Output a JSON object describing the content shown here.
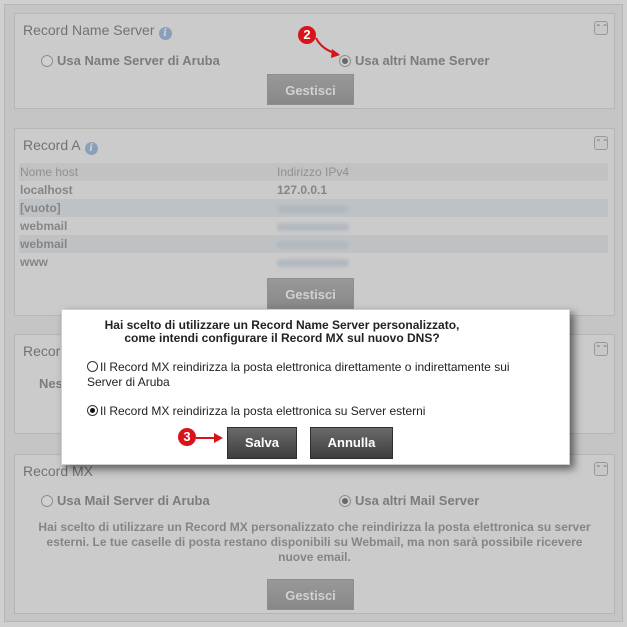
{
  "ns_section": {
    "title": "Record Name Server",
    "option_aruba": "Usa Name Server di Aruba",
    "option_other": "Usa altri Name Server",
    "selected": "option_other",
    "button": "Gestisci"
  },
  "a_section": {
    "title": "Record A",
    "headers": [
      "Nome host",
      "Indirizzo IPv4"
    ],
    "rows": [
      {
        "host": "localhost",
        "ip": "127.0.0.1"
      },
      {
        "host": "[vuoto]",
        "ip": ""
      },
      {
        "host": "webmail",
        "ip": ""
      },
      {
        "host": "webmail",
        "ip": ""
      },
      {
        "host": "www",
        "ip": ""
      }
    ],
    "button": "Gestisci"
  },
  "third_section": {
    "title": "Recor",
    "partial_text": "Nes"
  },
  "mx_section": {
    "title": "Record MX",
    "option_aruba": "Usa Mail Server di Aruba",
    "option_other": "Usa altri Mail Server",
    "selected": "option_other",
    "note": "Hai scelto di utilizzare un Record MX personalizzato che reindirizza la posta elettronica su server esterni. Le tue caselle di posta restano disponibili su Webmail, ma non sarà possibile ricevere nuove email.",
    "button": "Gestisci"
  },
  "dialog": {
    "question_line1": "Hai scelto di utilizzare un Record Name Server personalizzato,",
    "question_line2": "come intendi configurare il Record MX sul nuovo DNS?",
    "option1_line1": "Il Record MX reindirizza la posta elettronica direttamente o indirettamente sui",
    "option1_line2": "Server di Aruba",
    "option2": "Il Record MX reindirizza la posta elettronica su Server esterni",
    "selected": "option2",
    "save_button": "Salva",
    "cancel_button": "Annulla"
  },
  "annotations": {
    "step2": "2",
    "step3": "3",
    "color": "#d8141a"
  },
  "colors": {
    "background": "#ececec",
    "dialog_button": "#4f4f4f",
    "section_button": "#8a8a8a"
  }
}
